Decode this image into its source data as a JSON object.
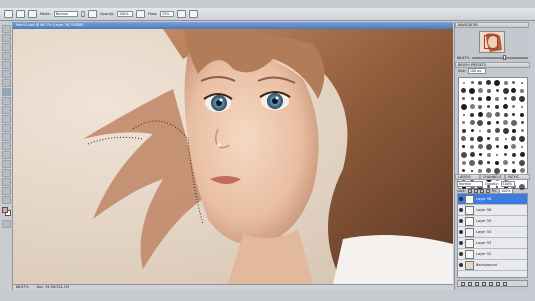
{
  "options_bar": {
    "mode_label": "Mode:",
    "mode_value": "Normal",
    "opacity_label": "Opacity:",
    "opacity_value": "100%",
    "flow_label": "Flow:",
    "flow_value": "25%"
  },
  "document": {
    "tab_title": "learn2.psd @ 66.7% (Layer 58, RGB/8)",
    "zoom": "66.67%",
    "doc_info": "Doc: 39.3M/101.1M"
  },
  "navigator": {
    "tab_label": "NAVIGATOR",
    "zoom_value": "66.67%"
  },
  "brushes": {
    "tab_label": "BRUSH PRESETS",
    "size_label": "Size:",
    "size_value": "100 px"
  },
  "layers": {
    "tabs": [
      "LAYERS",
      "CHANNELS",
      "PATHS"
    ],
    "blend_mode": "Normal",
    "opacity_label": "Opacity:",
    "opacity_value": "100%",
    "lock_label": "Lock:",
    "fill_label": "Fill:",
    "fill_value": "100%",
    "items": [
      {
        "name": "Layer 58",
        "selected": true
      },
      {
        "name": "Layer 56",
        "selected": false
      },
      {
        "name": "Layer 55",
        "selected": false
      },
      {
        "name": "Layer 54",
        "selected": false
      },
      {
        "name": "Layer 53",
        "selected": false
      },
      {
        "name": "Layer 52",
        "selected": false
      },
      {
        "name": "Background",
        "selected": false
      }
    ]
  }
}
